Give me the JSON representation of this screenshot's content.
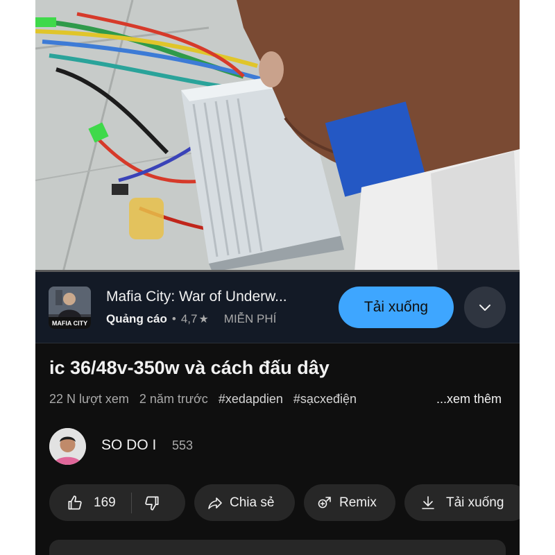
{
  "ad": {
    "title": "Mafia City: War of Underw...",
    "label": "Quảng cáo",
    "separator": "•",
    "rating": "4,7",
    "star_icon": "star-icon",
    "price": "MIỄN PHÍ",
    "download_label": "Tải xuống",
    "thumb_text": "MAFIA CITY"
  },
  "video": {
    "title": "ic 36/48v-350w và cách đấu dây",
    "views": "22 N lượt xem",
    "age": "2 năm trước",
    "tags": [
      "#xedapdien",
      "#sạcxeđiện"
    ],
    "more": "...xem thêm"
  },
  "channel": {
    "name": "SO DO I",
    "subscribers": "553"
  },
  "actions": {
    "likes": "169",
    "share": "Chia sẻ",
    "remix": "Remix",
    "download": "Tải xuống"
  },
  "colors": {
    "background": "#0f0f0f",
    "ad_background": "#131a26",
    "accent": "#3ea6ff",
    "pill": "#272727",
    "text_primary": "#f1f1f1",
    "text_secondary": "#aaaaaa"
  }
}
